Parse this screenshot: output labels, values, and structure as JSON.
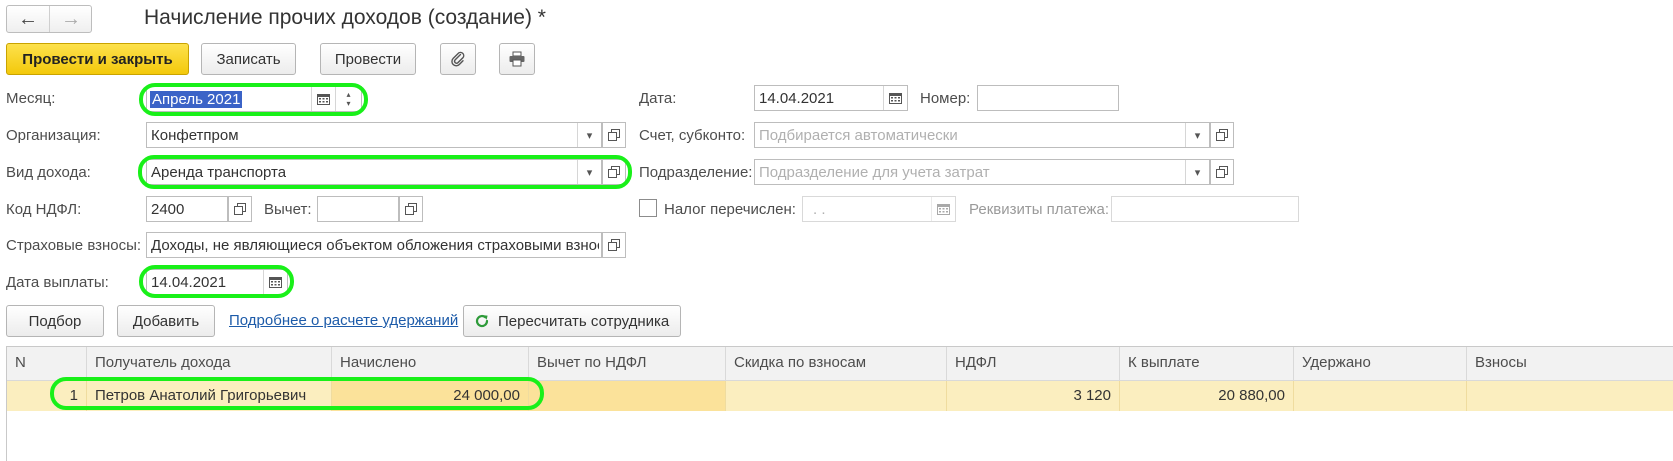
{
  "window": {
    "title": "Начисление прочих доходов (создание) *"
  },
  "nav": {
    "back": "←",
    "forward": "→"
  },
  "toolbar": {
    "post_close": "Провести и закрыть",
    "save": "Записать",
    "post": "Провести"
  },
  "form": {
    "month": {
      "label": "Месяц:",
      "value": "Апрель 2021"
    },
    "organization": {
      "label": "Организация:",
      "value": "Конфетпром"
    },
    "income_type": {
      "label": "Вид дохода:",
      "value": "Аренда транспорта"
    },
    "ndfl_code": {
      "label": "Код НДФЛ:",
      "value": "2400"
    },
    "deduction": {
      "label": "Вычет:",
      "value": ""
    },
    "insurance": {
      "label": "Страховые взносы:",
      "value": "Доходы, не являющиеся объектом обложения страховыми взносами"
    },
    "pay_date": {
      "label": "Дата выплаты:",
      "value": "14.04.2021"
    },
    "date": {
      "label": "Дата:",
      "value": "14.04.2021"
    },
    "number": {
      "label": "Номер:",
      "value": ""
    },
    "account": {
      "label": "Счет, субконто:",
      "placeholder": "Подбирается автоматически"
    },
    "division": {
      "label": "Подразделение:",
      "placeholder": "Подразделение для учета затрат"
    },
    "tax_paid": {
      "label": "Налог перечислен:",
      "date_placeholder": " .  .",
      "checked": false
    },
    "payment_details": {
      "label": "Реквизиты платежа:",
      "value": ""
    }
  },
  "actions": {
    "select": "Подбор",
    "add": "Добавить",
    "details_link": "Подробнее о расчете удержаний",
    "recalc": "Пересчитать сотрудника"
  },
  "table": {
    "columns": [
      "N",
      "Получатель дохода",
      "Начислено",
      "Вычет по НДФЛ",
      "Скидка по взносам",
      "НДФЛ",
      "К выплате",
      "Удержано",
      "Взносы"
    ],
    "rows": [
      {
        "n": "1",
        "recipient": "Петров Анатолий Григорьевич",
        "accrued": "24 000,00",
        "deduction": "",
        "discount": "",
        "ndfl": "3 120",
        "payout": "20 880,00",
        "withheld": "",
        "contrib": ""
      }
    ]
  },
  "colors": {
    "highlight": "#19f019",
    "primary": "#f3c90b",
    "row": "#fbeebf",
    "link": "#1d5ba9"
  }
}
